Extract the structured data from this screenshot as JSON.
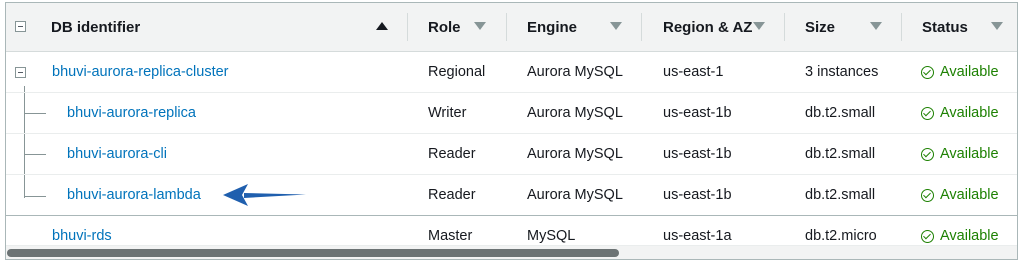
{
  "columns": [
    {
      "label": "DB identifier",
      "sort": "ascending"
    },
    {
      "label": "Role",
      "sort": "none"
    },
    {
      "label": "Engine",
      "sort": "none"
    },
    {
      "label": "Region & AZ",
      "sort": "none"
    },
    {
      "label": "Size",
      "sort": "none"
    },
    {
      "label": "Status",
      "sort": "none"
    }
  ],
  "rows": [
    {
      "id": "bhuvi-aurora-replica-cluster",
      "role": "Regional",
      "engine": "Aurora MySQL",
      "region": "us-east-1",
      "size": "3 instances",
      "status": "Available"
    },
    {
      "id": "bhuvi-aurora-replica",
      "role": "Writer",
      "engine": "Aurora MySQL",
      "region": "us-east-1b",
      "size": "db.t2.small",
      "status": "Available"
    },
    {
      "id": "bhuvi-aurora-cli",
      "role": "Reader",
      "engine": "Aurora MySQL",
      "region": "us-east-1b",
      "size": "db.t2.small",
      "status": "Available"
    },
    {
      "id": "bhuvi-aurora-lambda",
      "role": "Reader",
      "engine": "Aurora MySQL",
      "region": "us-east-1b",
      "size": "db.t2.small",
      "status": "Available"
    },
    {
      "id": "bhuvi-rds",
      "role": "Master",
      "engine": "MySQL",
      "region": "us-east-1a",
      "size": "db.t2.micro",
      "status": "Available"
    }
  ],
  "colors": {
    "link": "#0073bb",
    "status_available": "#1d8102",
    "annotation_arrow": "#1f5fae"
  }
}
